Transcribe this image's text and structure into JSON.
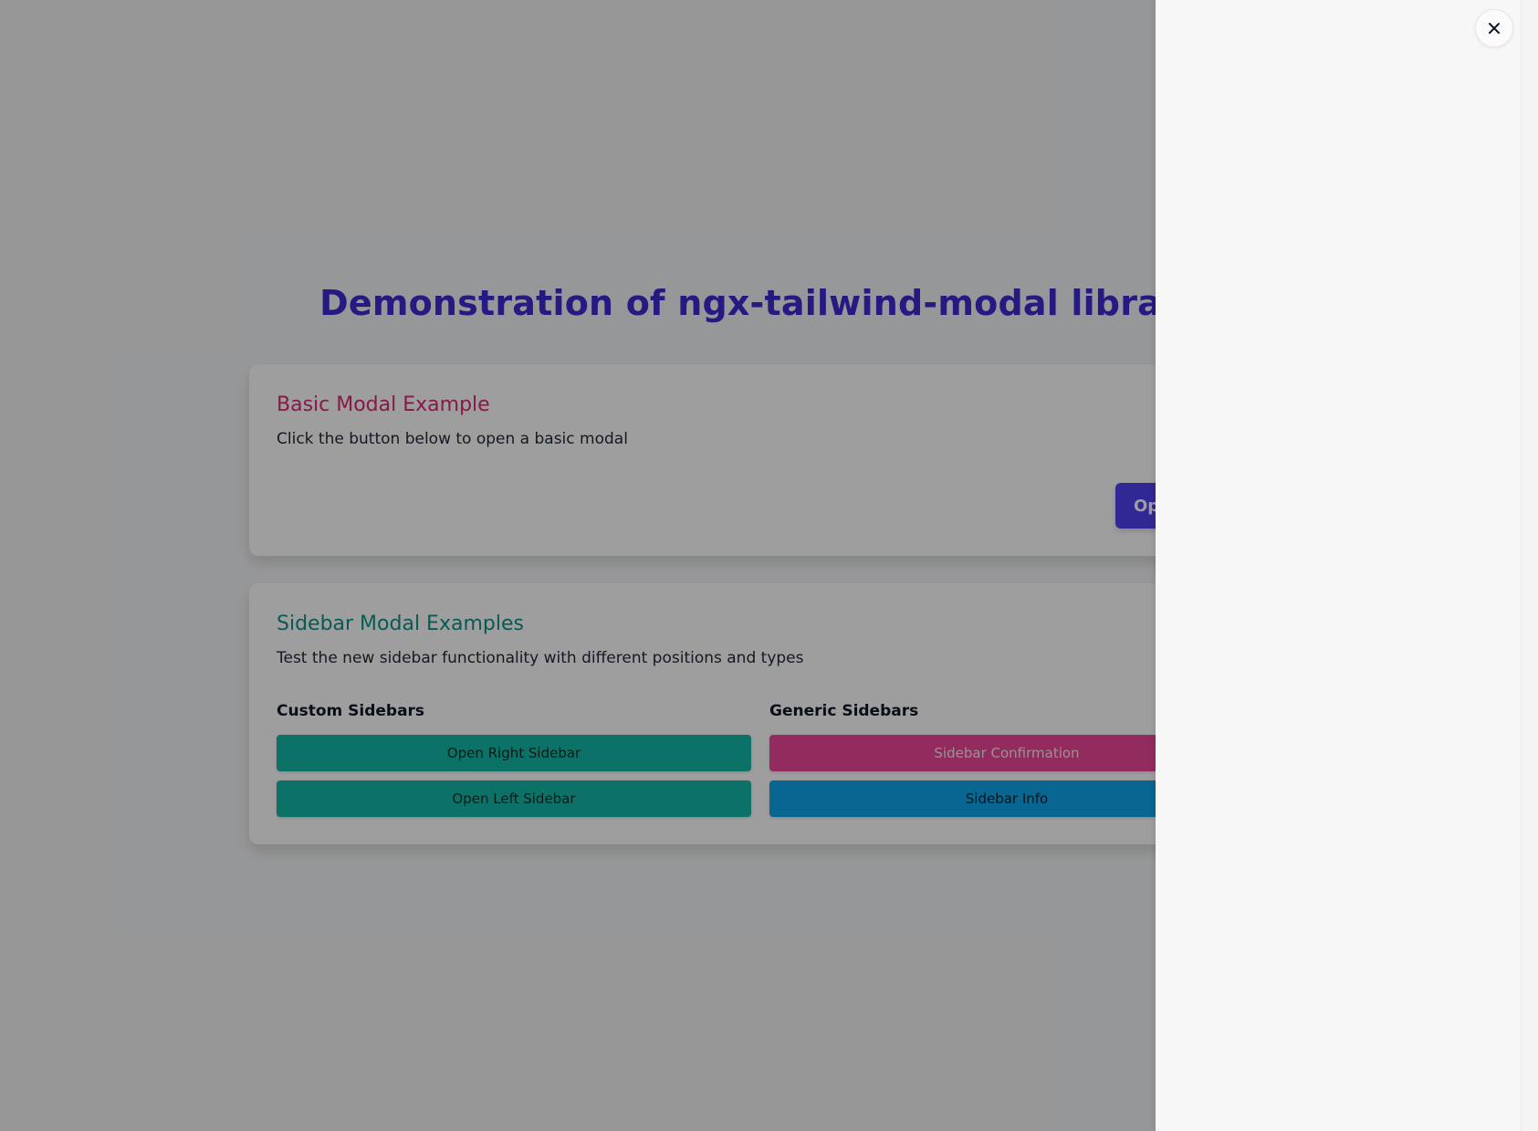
{
  "page": {
    "title": "Demonstration of ngx-tailwind-modal library"
  },
  "basic_card": {
    "title": "Basic Modal Example",
    "description": "Click the button below to open a basic modal",
    "open_button_label": "Op"
  },
  "sidebar_card": {
    "title": "Sidebar Modal Examples",
    "description": "Test the new sidebar functionality with different positions and types",
    "custom_label": "Custom Sidebars",
    "generic_label": "Generic Sidebars",
    "buttons": {
      "open_right": "Open Right Sidebar",
      "open_left": "Open Left Sidebar",
      "confirmation": "Sidebar Confirmation",
      "info": "Sidebar Info"
    }
  },
  "sidebar_panel": {
    "close_icon": "close-icon"
  },
  "colors": {
    "title_blue": "#3b2bd1",
    "basic_pink": "#db2777",
    "sidebar_teal": "#0d9488",
    "button_teal": "#14b8a6",
    "button_pink": "#ec4899",
    "button_blue": "#0ea5e9",
    "button_indigo": "#4f3ff0"
  }
}
